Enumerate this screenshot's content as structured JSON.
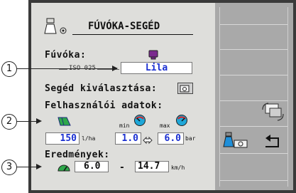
{
  "title": "FÚVÓKA-SEGÉD",
  "nozzle": {
    "label": "Fúvóka:",
    "iso": "ISO 025",
    "value": "Lila",
    "color": "#7a2a8e"
  },
  "helper_select": {
    "label": "Segéd kiválasztása:"
  },
  "user_data": {
    "label": "Felhasználói adatok:",
    "min_label": "min",
    "max_label": "max",
    "rate_value": "150",
    "rate_unit": "l/ha",
    "min_pressure": "1.0",
    "max_pressure": "6.0",
    "pressure_unit": "bar"
  },
  "results": {
    "label": "Eredmények:",
    "speed_min": "6.0",
    "separator": "-",
    "speed_max": "14.7",
    "speed_unit": "km/h"
  },
  "callouts": [
    "1",
    "2",
    "3"
  ],
  "icons": {
    "header": "nozzle-gear-icon",
    "nozzle_color": "nozzle-tip-icon",
    "helper": "helper-select-icon",
    "field": "field-area-icon",
    "gauge_min": "pressure-gauge-min-icon",
    "gauge_max": "pressure-gauge-max-icon",
    "swap": "swap-arrows-icon",
    "speedo": "speedometer-icon",
    "soft_swap": "swap-settings-icon",
    "soft_nozzle": "nozzle-settings-icon",
    "soft_back": "return-icon"
  },
  "colors": {
    "panel": "#dededb",
    "frame": "#3a3a3a",
    "softkey_bg": "#a9a9a9",
    "value_blue": "#1a2fd1"
  }
}
